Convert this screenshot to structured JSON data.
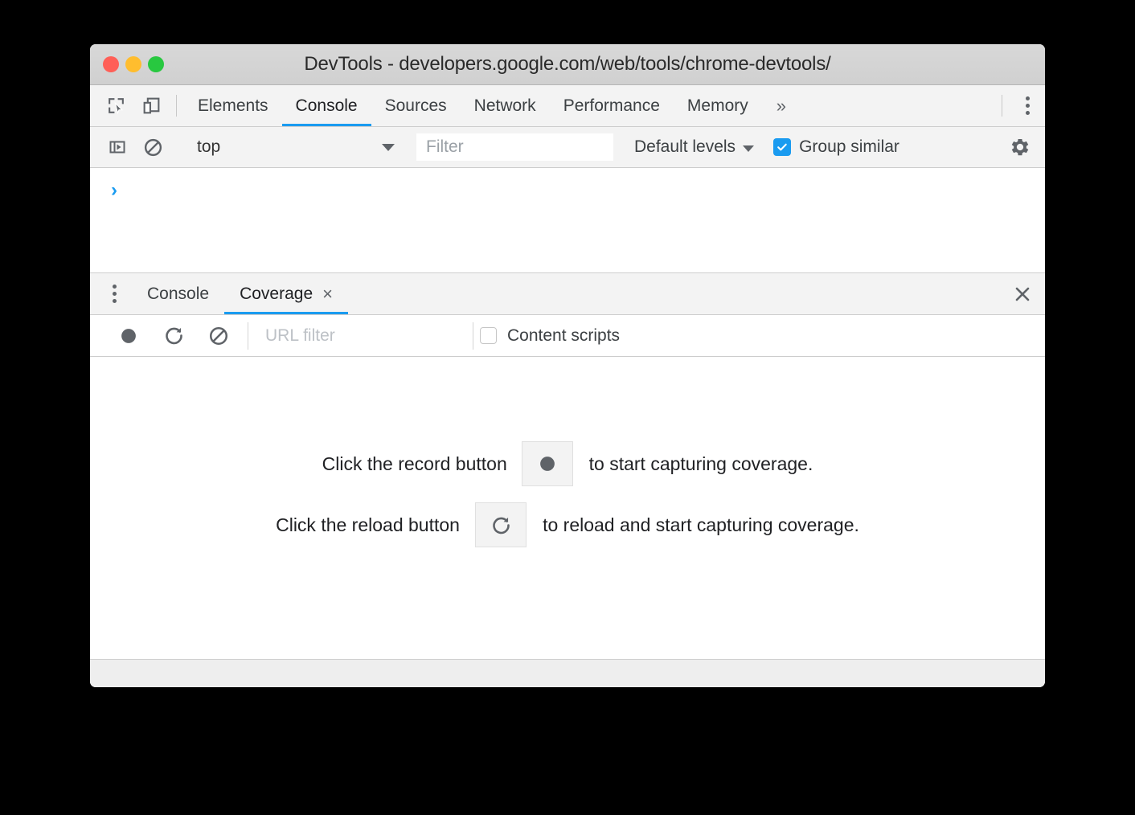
{
  "window": {
    "title": "DevTools - developers.google.com/web/tools/chrome-devtools/",
    "traffic_lights": {
      "close_color": "#ff5f57",
      "minimize_color": "#ffbd2e",
      "zoom_color": "#28c840"
    }
  },
  "accent_color": "#1a9bf0",
  "main_toolbar": {
    "inspect_icon": "inspect-element-icon",
    "device_toggle_icon": "device-toolbar-icon",
    "tabs": [
      {
        "label": "Elements",
        "selected": false
      },
      {
        "label": "Console",
        "selected": true
      },
      {
        "label": "Sources",
        "selected": false
      },
      {
        "label": "Network",
        "selected": false
      },
      {
        "label": "Performance",
        "selected": false
      },
      {
        "label": "Memory",
        "selected": false
      }
    ],
    "more_tabs_label": "»",
    "main_menu_icon": "kebab-menu-icon"
  },
  "console_toolbar": {
    "sidebar_icon": "console-sidebar-icon",
    "clear_icon": "clear-console-icon",
    "context": {
      "value": "top"
    },
    "filter": {
      "placeholder": "Filter",
      "value": ""
    },
    "levels": {
      "label": "Default levels"
    },
    "group_similar": {
      "label": "Group similar",
      "checked": true
    },
    "settings_icon": "gear-icon"
  },
  "console_output": {
    "prompt": "›"
  },
  "drawer": {
    "menu_icon": "drawer-kebab-icon",
    "tabs": [
      {
        "label": "Console",
        "selected": false,
        "closable": false
      },
      {
        "label": "Coverage",
        "selected": true,
        "closable": true,
        "close_label": "×"
      }
    ],
    "close_label": "✕"
  },
  "coverage_toolbar": {
    "record_icon": "record-icon",
    "reload_icon": "reload-icon",
    "clear_icon": "clear-icon",
    "url_filter": {
      "placeholder": "URL filter",
      "value": ""
    },
    "content_scripts": {
      "label": "Content scripts",
      "checked": false
    }
  },
  "coverage_empty": {
    "rows": [
      {
        "pre": "Click the record button",
        "icon": "record-icon",
        "post": "to start capturing coverage."
      },
      {
        "pre": "Click the reload button",
        "icon": "reload-icon",
        "post": "to reload and start capturing coverage."
      }
    ]
  }
}
